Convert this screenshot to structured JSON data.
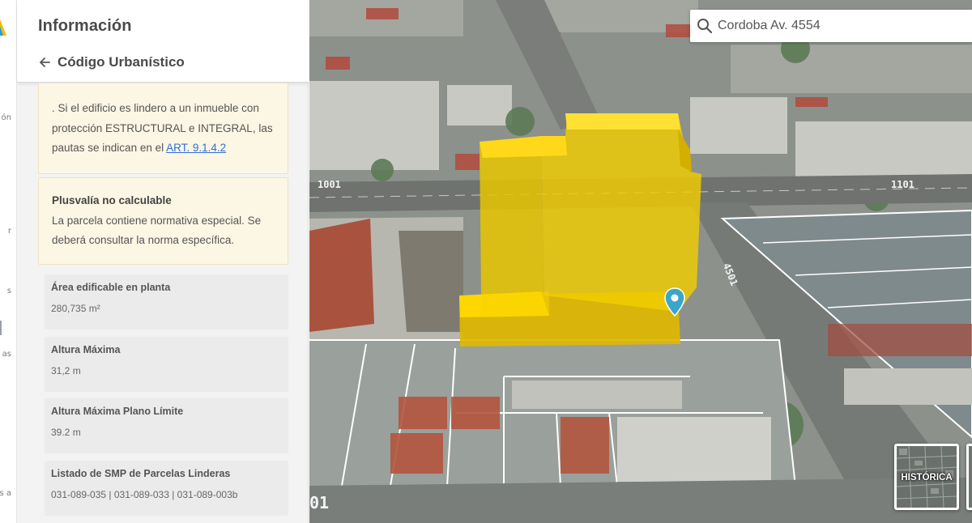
{
  "rail": {
    "fragments": [
      "ón",
      "r",
      "s",
      "as",
      "s a"
    ]
  },
  "panel": {
    "title": "Información",
    "back_label": "Código Urbanístico"
  },
  "notes": {
    "protection_text": ". Si el edificio es lindero a un inmueble con protección ESTRUCTURAL e INTEGRAL, las pautas se indican en el",
    "protection_link": "ART. 9.1.4.2",
    "plusvalia_title": "Plusvalía no calculable",
    "plusvalia_text": "La parcela contiene normativa especial. Se deberá consultar la norma específica."
  },
  "cards": [
    {
      "label": "Área edificable en planta",
      "value": "280,735 m²"
    },
    {
      "label": "Altura Máxima",
      "value": "31,2 m"
    },
    {
      "label": "Altura Máxima Plano Límite",
      "value": "39.2 m"
    },
    {
      "label": "Listado de SMP de Parcelas Linderas",
      "value": "031-089-035 | 031-089-033 | 031-089-003b"
    }
  ],
  "search": {
    "value": "Cordoba Av. 4554"
  },
  "map": {
    "street_labels": [
      "1001",
      "1101",
      "4501",
      "01"
    ],
    "layer_toggle": "HISTÓRICA",
    "volume_color": "#f2cd00"
  },
  "icons": [
    "logo-icon",
    "arrow-left-icon",
    "search-icon",
    "map-pin-icon"
  ]
}
